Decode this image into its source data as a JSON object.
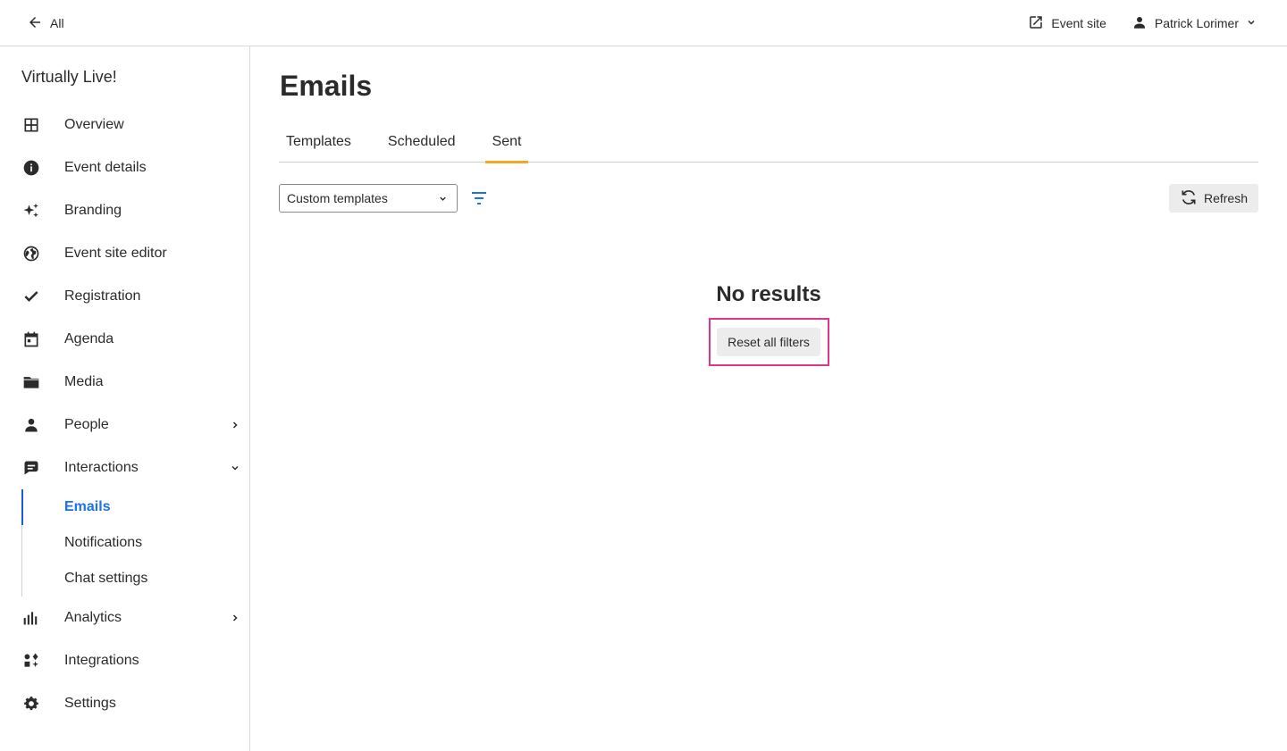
{
  "topbar": {
    "back_label": "All",
    "event_site_label": "Event site",
    "user_name": "Patrick Lorimer"
  },
  "sidebar": {
    "event_name": "Virtually Live!",
    "items": [
      {
        "label": "Overview",
        "icon": "grid-icon"
      },
      {
        "label": "Event details",
        "icon": "info-icon"
      },
      {
        "label": "Branding",
        "icon": "sparkle-icon"
      },
      {
        "label": "Event site editor",
        "icon": "globe-icon"
      },
      {
        "label": "Registration",
        "icon": "check-icon"
      },
      {
        "label": "Agenda",
        "icon": "calendar-icon"
      },
      {
        "label": "Media",
        "icon": "folder-icon"
      },
      {
        "label": "People",
        "icon": "person-icon",
        "expandable": true
      },
      {
        "label": "Interactions",
        "icon": "chat-icon",
        "expanded": true
      }
    ],
    "sub_items": [
      {
        "label": "Emails",
        "active": true
      },
      {
        "label": "Notifications"
      },
      {
        "label": "Chat settings"
      }
    ],
    "items_after": [
      {
        "label": "Analytics",
        "icon": "bar-chart-icon",
        "expandable": true
      },
      {
        "label": "Integrations",
        "icon": "puzzle-icon"
      },
      {
        "label": "Settings",
        "icon": "gear-icon"
      }
    ]
  },
  "main": {
    "title": "Emails",
    "tabs": [
      {
        "label": "Templates"
      },
      {
        "label": "Scheduled"
      },
      {
        "label": "Sent",
        "active": true
      }
    ],
    "filter_select": {
      "value": "Custom templates"
    },
    "refresh_label": "Refresh",
    "empty_title": "No results",
    "reset_label": "Reset all filters"
  },
  "colors": {
    "accent_blue": "#1a73e8",
    "tab_underline": "#f5a623",
    "highlight_frame": "#e0358c",
    "button_bg": "#ececec"
  }
}
